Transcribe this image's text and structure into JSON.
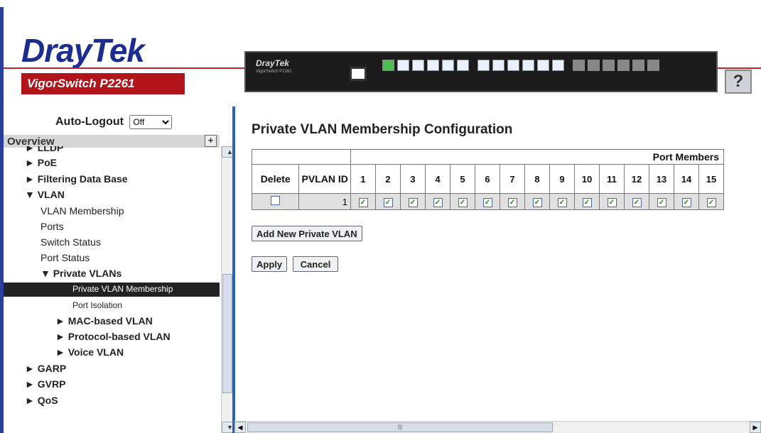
{
  "header": {
    "logo_dray": "Dray",
    "logo_tek": "Tek",
    "model": "VigorSwitch P2261",
    "device_brand": "DrayTek",
    "device_model": "VigorSwitch P2261",
    "help_label": "?"
  },
  "sidebar": {
    "auto_logout_label": "Auto-Logout",
    "auto_logout_value": "Off",
    "overview_label": "Overview",
    "overview_toggle": "+",
    "items": [
      {
        "label": "► LLDP"
      },
      {
        "label": "► PoE"
      },
      {
        "label": "► Filtering Data Base"
      },
      {
        "label": "▼ VLAN"
      },
      {
        "label": "VLAN Membership"
      },
      {
        "label": "Ports"
      },
      {
        "label": "Switch Status"
      },
      {
        "label": "Port Status"
      },
      {
        "label": "▼ Private VLANs"
      },
      {
        "label": "Private VLAN Membership"
      },
      {
        "label": "Port Isolation"
      },
      {
        "label": "► MAC-based VLAN"
      },
      {
        "label": "► Protocol-based VLAN"
      },
      {
        "label": "► Voice VLAN"
      },
      {
        "label": "► GARP"
      },
      {
        "label": "► GVRP"
      },
      {
        "label": "► QoS"
      }
    ]
  },
  "main": {
    "title": "Private VLAN Membership Configuration",
    "table": {
      "port_members_label": "Port Members",
      "col_delete": "Delete",
      "col_pvlan_id": "PVLAN ID",
      "ports": [
        "1",
        "2",
        "3",
        "4",
        "5",
        "6",
        "7",
        "8",
        "9",
        "10",
        "11",
        "12",
        "13",
        "14",
        "15"
      ],
      "rows": [
        {
          "delete": false,
          "pvlan_id": "1",
          "members": [
            true,
            true,
            true,
            true,
            true,
            true,
            true,
            true,
            true,
            true,
            true,
            true,
            true,
            true,
            true
          ]
        }
      ]
    },
    "add_button": "Add New Private VLAN",
    "apply_button": "Apply",
    "cancel_button": "Cancel"
  },
  "colors": {
    "brand_blue": "#1b2d8f",
    "brand_red": "#b2141c",
    "selected_bg": "#222222",
    "divider": "#2a63b8"
  }
}
